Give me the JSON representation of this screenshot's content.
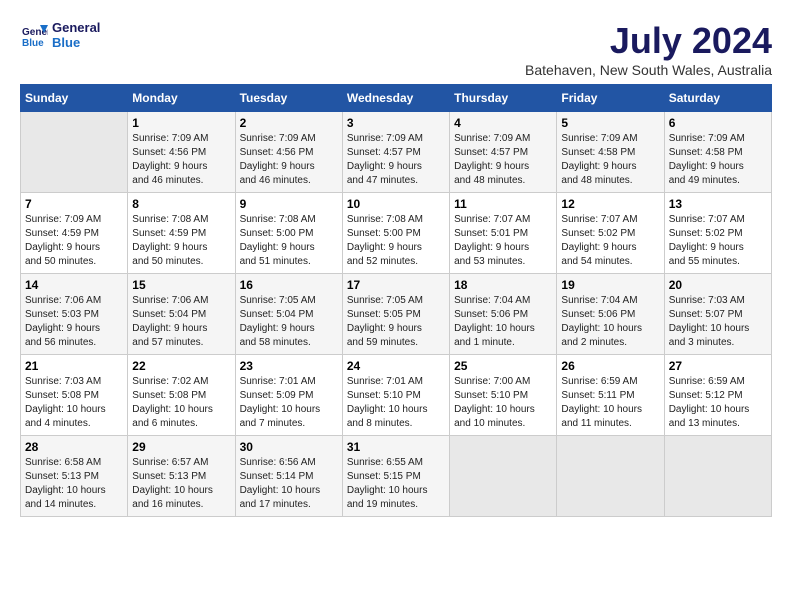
{
  "logo": {
    "line1": "General",
    "line2": "Blue"
  },
  "title": "July 2024",
  "subtitle": "Batehaven, New South Wales, Australia",
  "headers": [
    "Sunday",
    "Monday",
    "Tuesday",
    "Wednesday",
    "Thursday",
    "Friday",
    "Saturday"
  ],
  "weeks": [
    [
      {
        "day": "",
        "info": ""
      },
      {
        "day": "1",
        "info": "Sunrise: 7:09 AM\nSunset: 4:56 PM\nDaylight: 9 hours\nand 46 minutes."
      },
      {
        "day": "2",
        "info": "Sunrise: 7:09 AM\nSunset: 4:56 PM\nDaylight: 9 hours\nand 46 minutes."
      },
      {
        "day": "3",
        "info": "Sunrise: 7:09 AM\nSunset: 4:57 PM\nDaylight: 9 hours\nand 47 minutes."
      },
      {
        "day": "4",
        "info": "Sunrise: 7:09 AM\nSunset: 4:57 PM\nDaylight: 9 hours\nand 48 minutes."
      },
      {
        "day": "5",
        "info": "Sunrise: 7:09 AM\nSunset: 4:58 PM\nDaylight: 9 hours\nand 48 minutes."
      },
      {
        "day": "6",
        "info": "Sunrise: 7:09 AM\nSunset: 4:58 PM\nDaylight: 9 hours\nand 49 minutes."
      }
    ],
    [
      {
        "day": "7",
        "info": "Sunrise: 7:09 AM\nSunset: 4:59 PM\nDaylight: 9 hours\nand 50 minutes."
      },
      {
        "day": "8",
        "info": "Sunrise: 7:08 AM\nSunset: 4:59 PM\nDaylight: 9 hours\nand 50 minutes."
      },
      {
        "day": "9",
        "info": "Sunrise: 7:08 AM\nSunset: 5:00 PM\nDaylight: 9 hours\nand 51 minutes."
      },
      {
        "day": "10",
        "info": "Sunrise: 7:08 AM\nSunset: 5:00 PM\nDaylight: 9 hours\nand 52 minutes."
      },
      {
        "day": "11",
        "info": "Sunrise: 7:07 AM\nSunset: 5:01 PM\nDaylight: 9 hours\nand 53 minutes."
      },
      {
        "day": "12",
        "info": "Sunrise: 7:07 AM\nSunset: 5:02 PM\nDaylight: 9 hours\nand 54 minutes."
      },
      {
        "day": "13",
        "info": "Sunrise: 7:07 AM\nSunset: 5:02 PM\nDaylight: 9 hours\nand 55 minutes."
      }
    ],
    [
      {
        "day": "14",
        "info": "Sunrise: 7:06 AM\nSunset: 5:03 PM\nDaylight: 9 hours\nand 56 minutes."
      },
      {
        "day": "15",
        "info": "Sunrise: 7:06 AM\nSunset: 5:04 PM\nDaylight: 9 hours\nand 57 minutes."
      },
      {
        "day": "16",
        "info": "Sunrise: 7:05 AM\nSunset: 5:04 PM\nDaylight: 9 hours\nand 58 minutes."
      },
      {
        "day": "17",
        "info": "Sunrise: 7:05 AM\nSunset: 5:05 PM\nDaylight: 9 hours\nand 59 minutes."
      },
      {
        "day": "18",
        "info": "Sunrise: 7:04 AM\nSunset: 5:06 PM\nDaylight: 10 hours\nand 1 minute."
      },
      {
        "day": "19",
        "info": "Sunrise: 7:04 AM\nSunset: 5:06 PM\nDaylight: 10 hours\nand 2 minutes."
      },
      {
        "day": "20",
        "info": "Sunrise: 7:03 AM\nSunset: 5:07 PM\nDaylight: 10 hours\nand 3 minutes."
      }
    ],
    [
      {
        "day": "21",
        "info": "Sunrise: 7:03 AM\nSunset: 5:08 PM\nDaylight: 10 hours\nand 4 minutes."
      },
      {
        "day": "22",
        "info": "Sunrise: 7:02 AM\nSunset: 5:08 PM\nDaylight: 10 hours\nand 6 minutes."
      },
      {
        "day": "23",
        "info": "Sunrise: 7:01 AM\nSunset: 5:09 PM\nDaylight: 10 hours\nand 7 minutes."
      },
      {
        "day": "24",
        "info": "Sunrise: 7:01 AM\nSunset: 5:10 PM\nDaylight: 10 hours\nand 8 minutes."
      },
      {
        "day": "25",
        "info": "Sunrise: 7:00 AM\nSunset: 5:10 PM\nDaylight: 10 hours\nand 10 minutes."
      },
      {
        "day": "26",
        "info": "Sunrise: 6:59 AM\nSunset: 5:11 PM\nDaylight: 10 hours\nand 11 minutes."
      },
      {
        "day": "27",
        "info": "Sunrise: 6:59 AM\nSunset: 5:12 PM\nDaylight: 10 hours\nand 13 minutes."
      }
    ],
    [
      {
        "day": "28",
        "info": "Sunrise: 6:58 AM\nSunset: 5:13 PM\nDaylight: 10 hours\nand 14 minutes."
      },
      {
        "day": "29",
        "info": "Sunrise: 6:57 AM\nSunset: 5:13 PM\nDaylight: 10 hours\nand 16 minutes."
      },
      {
        "day": "30",
        "info": "Sunrise: 6:56 AM\nSunset: 5:14 PM\nDaylight: 10 hours\nand 17 minutes."
      },
      {
        "day": "31",
        "info": "Sunrise: 6:55 AM\nSunset: 5:15 PM\nDaylight: 10 hours\nand 19 minutes."
      },
      {
        "day": "",
        "info": ""
      },
      {
        "day": "",
        "info": ""
      },
      {
        "day": "",
        "info": ""
      }
    ]
  ]
}
